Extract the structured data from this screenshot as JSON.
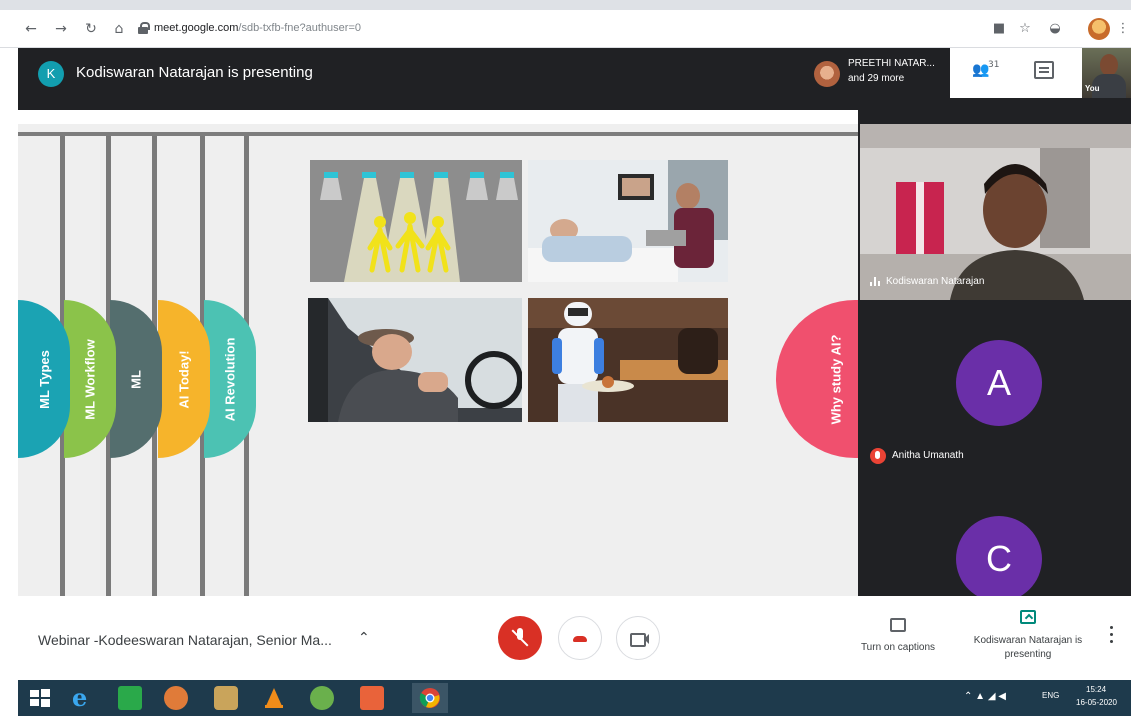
{
  "browser": {
    "url_domain": "meet.google.com",
    "url_rest": "/sdb-txfb-fne?authuser=0",
    "nav_icons": [
      "back-arrow-icon",
      "forward-arrow-icon",
      "reload-icon",
      "home-icon"
    ],
    "right_icons": [
      "camera-icon",
      "star-icon",
      "extension-icon",
      "profile-icon",
      "menu-icon"
    ]
  },
  "meet_header": {
    "presenter_initial": "K",
    "presenting_text": "Kodiswaran Natarajan is presenting",
    "participants_line1": "PREETHI NATAR...",
    "participants_line2": "and 29 more",
    "people_count": "31",
    "self_label": "You"
  },
  "slide": {
    "tabs": [
      {
        "label": "ML Types",
        "color": "#1ba3b3"
      },
      {
        "label": "ML Workflow",
        "color": "#8bc34a"
      },
      {
        "label": "ML",
        "color": "#546e6e"
      },
      {
        "label": "AI Today!",
        "color": "#f6b42b"
      },
      {
        "label": "AI Revolution",
        "color": "#4cc2b3"
      }
    ],
    "right_tab": {
      "label": "Why study AI?",
      "color": "#f0506e"
    },
    "photos": [
      "smart-lighting-photo",
      "telemedicine-photo",
      "tired-driver-photo",
      "robot-waiter-photo"
    ]
  },
  "participants": [
    {
      "name": "Kodiswaran Natarajan",
      "type": "video"
    },
    {
      "name": "Anitha Umanath",
      "initial": "A",
      "muted": true
    },
    {
      "name": "",
      "initial": "C"
    }
  ],
  "bottom_bar": {
    "meeting_title": "Webinar -Kodeeswaran Natarajan, Senior Ma...",
    "captions_label": "Turn on captions",
    "presenting_label": "Kodiswaran Natarajan is presenting"
  },
  "taskbar": {
    "apps": [
      "windows-start-icon",
      "internet-explorer-icon",
      "app-icon",
      "paint-icon",
      "app-icon",
      "vlc-icon",
      "utorrent-icon",
      "app-icon",
      "chrome-icon"
    ],
    "lang": "ENG",
    "time": "15:24",
    "date": "16-05-2020"
  }
}
